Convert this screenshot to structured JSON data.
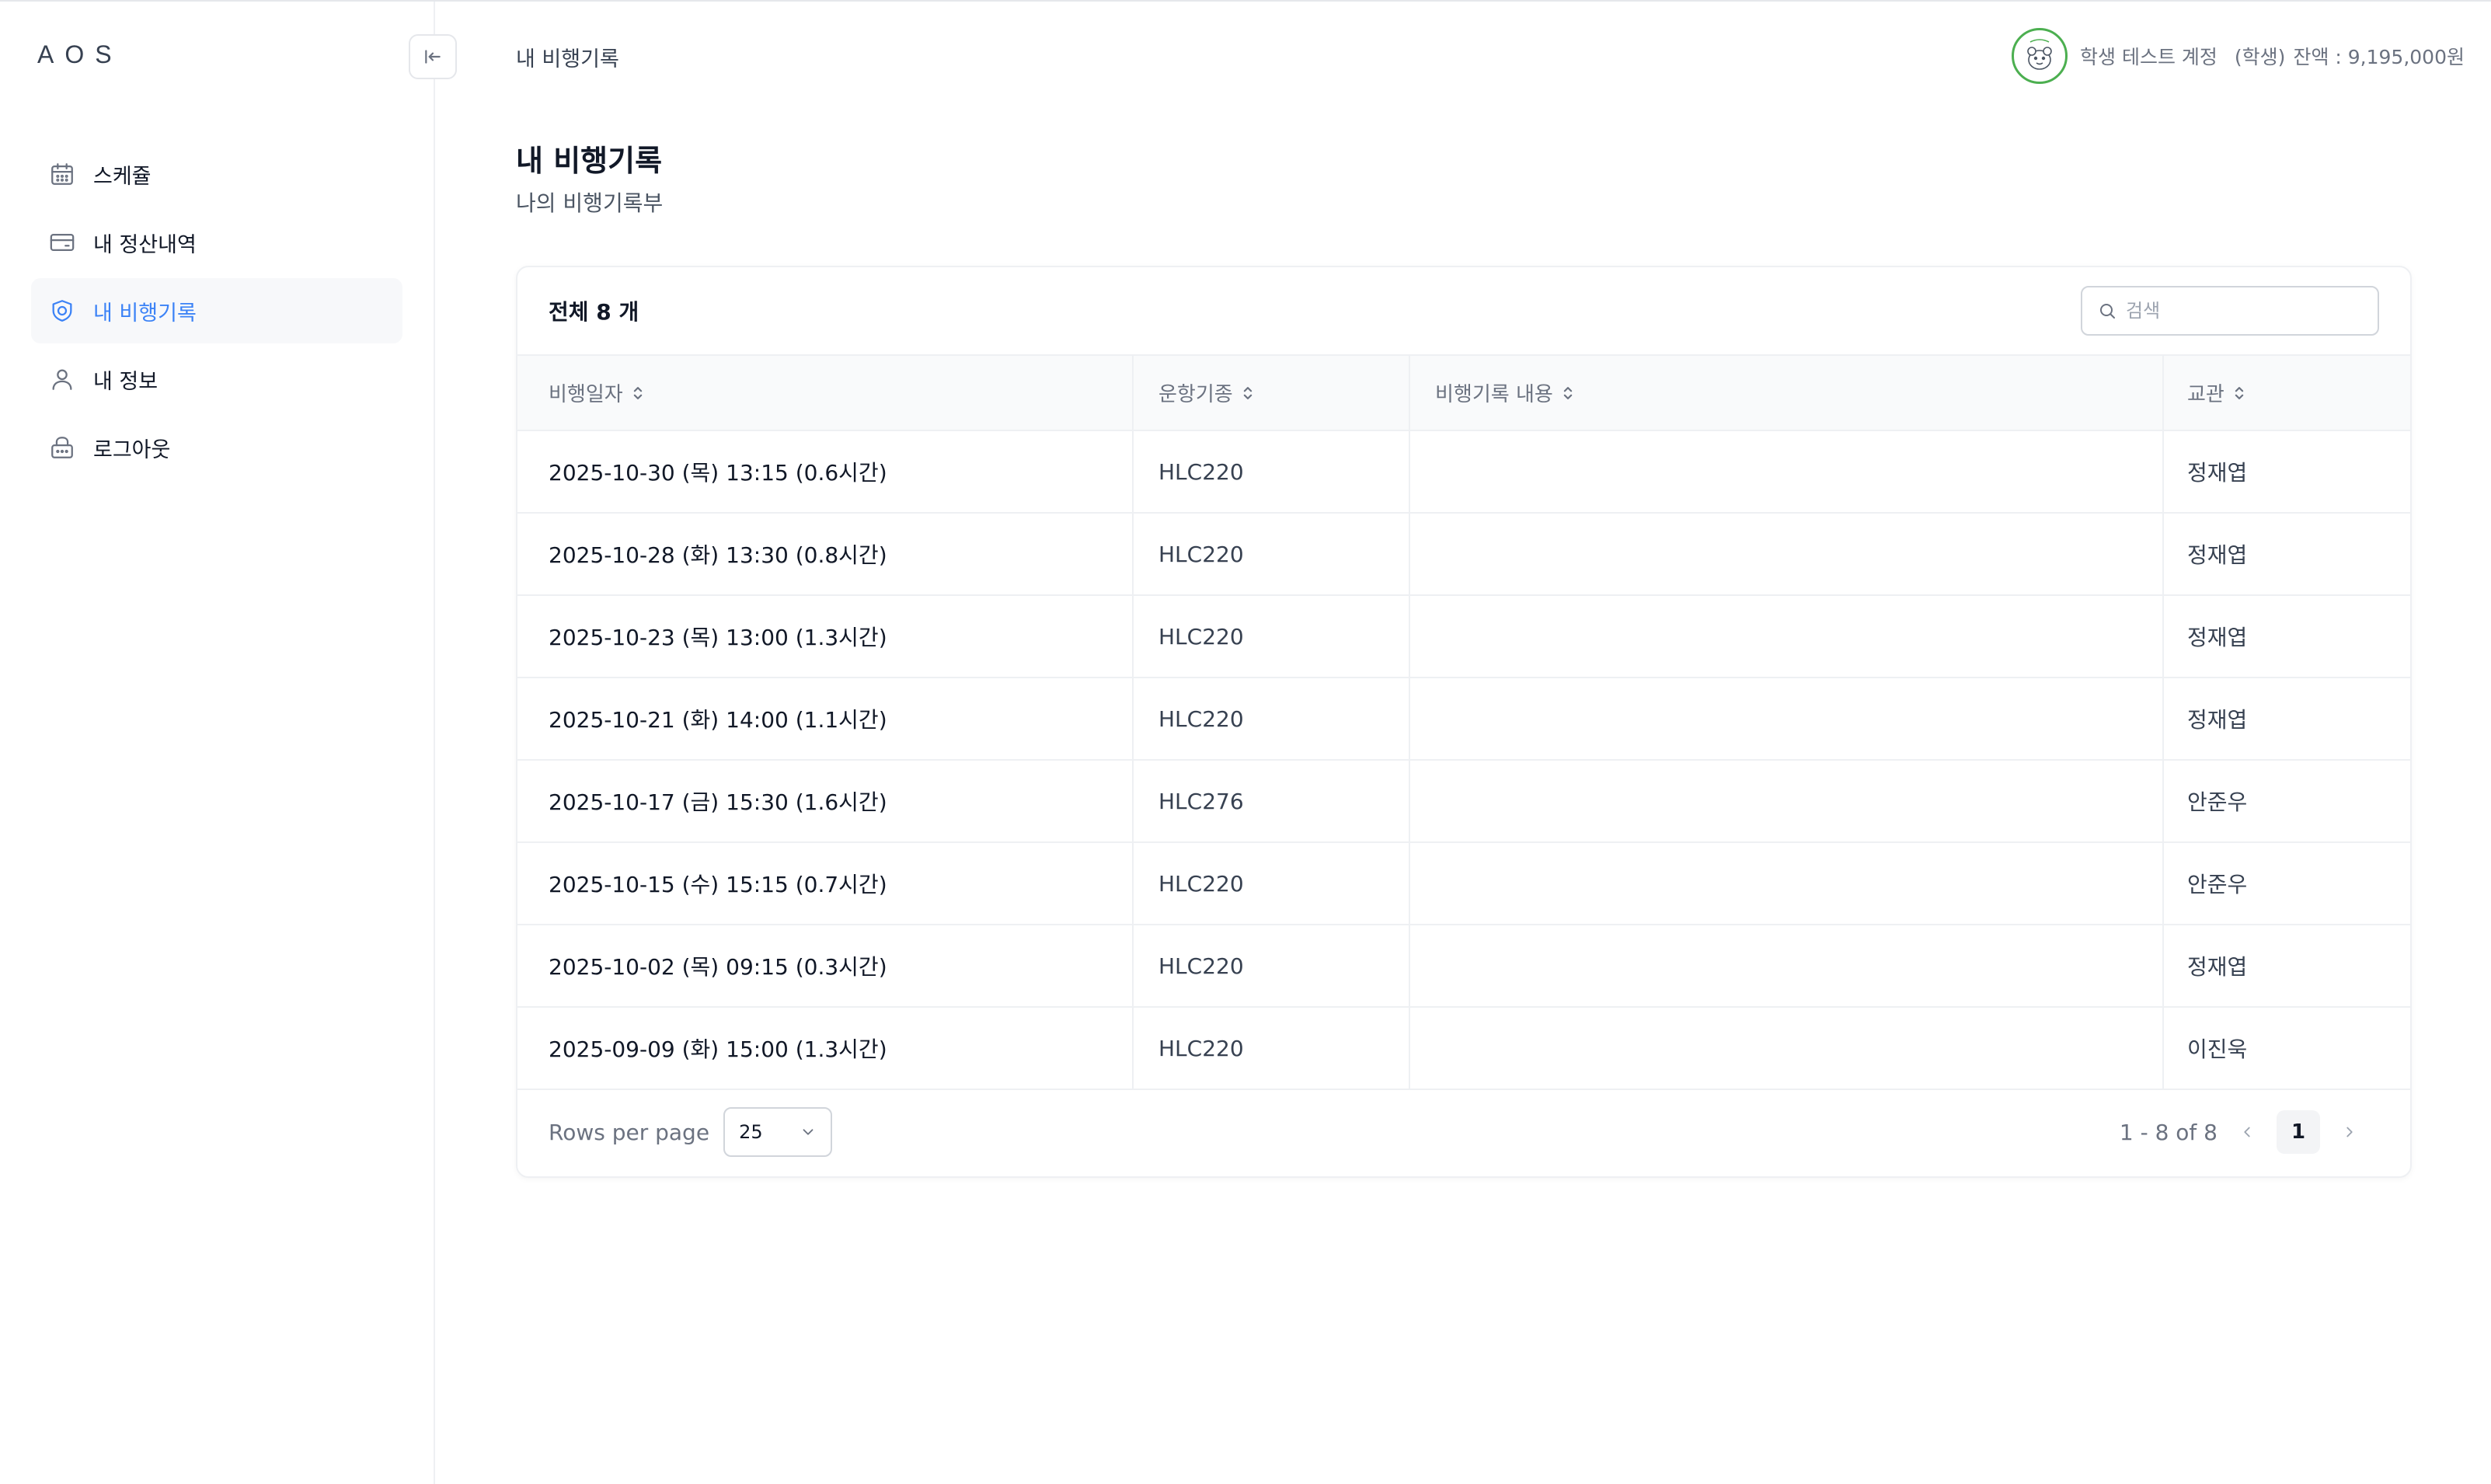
{
  "brand": "AOS",
  "sidebar": {
    "items": [
      {
        "label": "스케쥴",
        "icon": "calendar-icon"
      },
      {
        "label": "내 정산내역",
        "icon": "credit-card-icon"
      },
      {
        "label": "내 비행기록",
        "icon": "shield-icon",
        "active": true
      },
      {
        "label": "내 정보",
        "icon": "user-icon"
      },
      {
        "label": "로그아웃",
        "icon": "lock-icon"
      }
    ]
  },
  "header": {
    "breadcrumb": "내 비행기록",
    "user_name": "학생 테스트 계정",
    "user_role": "(학생)",
    "balance": "잔액 : 9,195,000원"
  },
  "page": {
    "title": "내 비행기록",
    "subtitle": "나의 비행기록부"
  },
  "table": {
    "total_label": "전체 8 개",
    "search_placeholder": "검색",
    "columns": [
      "비행일자",
      "운항기종",
      "비행기록 내용",
      "교관"
    ],
    "rows": [
      {
        "date": "2025-10-30 (목) 13:15 (0.6시간)",
        "aircraft": "HLC220",
        "content": "",
        "instructor": "정재엽"
      },
      {
        "date": "2025-10-28 (화) 13:30 (0.8시간)",
        "aircraft": "HLC220",
        "content": "",
        "instructor": "정재엽"
      },
      {
        "date": "2025-10-23 (목) 13:00 (1.3시간)",
        "aircraft": "HLC220",
        "content": "",
        "instructor": "정재엽"
      },
      {
        "date": "2025-10-21 (화) 14:00 (1.1시간)",
        "aircraft": "HLC220",
        "content": "",
        "instructor": "정재엽"
      },
      {
        "date": "2025-10-17 (금) 15:30 (1.6시간)",
        "aircraft": "HLC276",
        "content": "",
        "instructor": "안준우"
      },
      {
        "date": "2025-10-15 (수) 15:15 (0.7시간)",
        "aircraft": "HLC220",
        "content": "",
        "instructor": "안준우"
      },
      {
        "date": "2025-10-02 (목) 09:15 (0.3시간)",
        "aircraft": "HLC220",
        "content": "",
        "instructor": "정재엽"
      },
      {
        "date": "2025-09-09 (화) 15:00 (1.3시간)",
        "aircraft": "HLC220",
        "content": "",
        "instructor": "이진욱"
      }
    ]
  },
  "pagination": {
    "rows_per_page_label": "Rows per page",
    "rows_per_page_value": "25",
    "range_label": "1 - 8 of 8",
    "current_page": "1"
  },
  "colors": {
    "accent": "#3b82f6",
    "avatar_ring": "#4caf50"
  }
}
